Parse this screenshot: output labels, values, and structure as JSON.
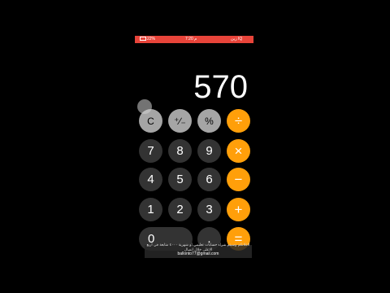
{
  "status_bar": {
    "left": "22%",
    "center": "7:20 م",
    "right": "زين IQ"
  },
  "display": {
    "value": "570"
  },
  "keys": {
    "clear": "C",
    "sign": "⁺∕₋",
    "percent": "%",
    "divide": "÷",
    "seven": "7",
    "eight": "8",
    "nine": "9",
    "multiply": "×",
    "four": "4",
    "five": "5",
    "six": "6",
    "minus": "−",
    "one": "1",
    "two": "2",
    "three": "3",
    "plus": "+",
    "zero": "0",
    "decimal": ".",
    "equals": "="
  },
  "overlay": {
    "text": "لاعلانكم وسيتم شراء حسابات تعليمي او شهرية ٤٠٠٠ متابعة في اربع الاعلى خلال اتصال",
    "email": "ballonto77@gmail.com"
  },
  "colors": {
    "status_bar": "#e8443a",
    "operator": "#ff9f0a",
    "function_key": "#a5a5a5",
    "digit_key": "#333333"
  }
}
